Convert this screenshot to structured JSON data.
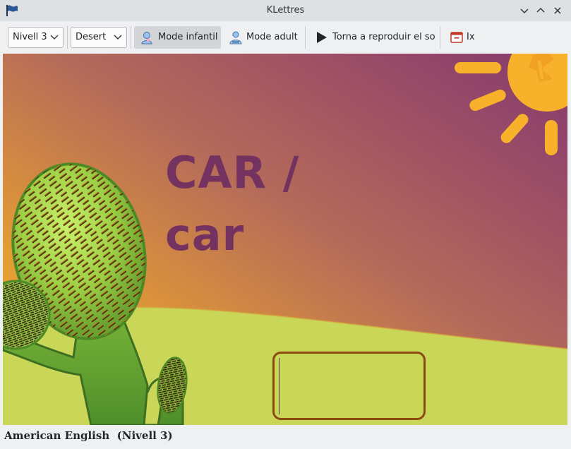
{
  "window": {
    "title": "KLettres"
  },
  "toolbar": {
    "level_combo": "Nivell 3",
    "theme_combo": "Desert",
    "kid_mode_label": "Mode infantil",
    "adult_mode_label": "Mode adult",
    "replay_label": "Torna a reproduir el so",
    "quit_label": "Ix"
  },
  "game": {
    "word_upper": "CAR /",
    "word_lower": "car",
    "answer_value": ""
  },
  "status": {
    "language": "American English",
    "level": "(Nivell 3)"
  },
  "colors": {
    "word": "#73325f",
    "sky_top_right": "#8a3a6e",
    "sky_bottom_left": "#f0b429",
    "sand": "#c9d657",
    "sun": "#f7b12a",
    "cactus": "#5f9e32",
    "answer_border": "#8b4a10"
  }
}
